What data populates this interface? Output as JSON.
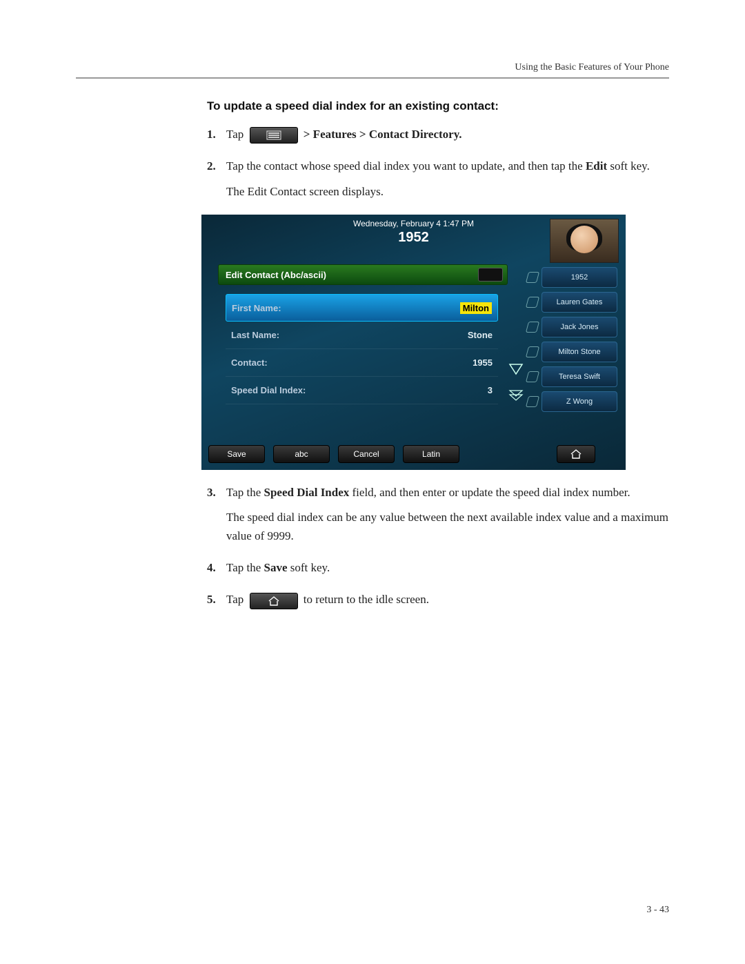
{
  "header": {
    "chapter_title": "Using the Basic Features of Your Phone"
  },
  "section": {
    "title": "To update a speed dial index for an existing contact:"
  },
  "steps": {
    "s1": {
      "num": "1.",
      "pre": "Tap ",
      "post": " > Features > Contact Directory."
    },
    "s2": {
      "num": "2.",
      "line1a": "Tap the contact whose speed dial index you want to update, and then tap the ",
      "line1b": "Edit",
      "line1c": " soft key.",
      "line2": "The Edit Contact screen displays."
    },
    "s3": {
      "num": "3.",
      "line1a": "Tap the ",
      "line1b": "Speed Dial Index",
      "line1c": " field, and then enter or update the speed dial index number.",
      "line2": "The speed dial index can be any value between the next available index value and a maximum value of 9999."
    },
    "s4": {
      "num": "4.",
      "a": "Tap the ",
      "b": "Save",
      "c": " soft key."
    },
    "s5": {
      "num": "5.",
      "pre": "Tap ",
      "post": " to return to the idle screen."
    }
  },
  "phone": {
    "date": "Wednesday, February 4  1:47 PM",
    "extension": "1952",
    "title": "Edit Contact (Abc/ascii)",
    "fields": [
      {
        "label": "First Name:",
        "value": "Milton",
        "selected": true
      },
      {
        "label": "Last Name:",
        "value": "Stone",
        "selected": false
      },
      {
        "label": "Contact:",
        "value": "1955",
        "selected": false
      },
      {
        "label": "Speed Dial Index:",
        "value": "3",
        "selected": false
      }
    ],
    "side": [
      "1952",
      "Lauren Gates",
      "Jack Jones",
      "Milton Stone",
      "Teresa Swift",
      "Z Wong"
    ],
    "softkeys": [
      "Save",
      "abc",
      "Cancel",
      "Latin"
    ]
  },
  "footer": {
    "page": "3 - 43"
  }
}
